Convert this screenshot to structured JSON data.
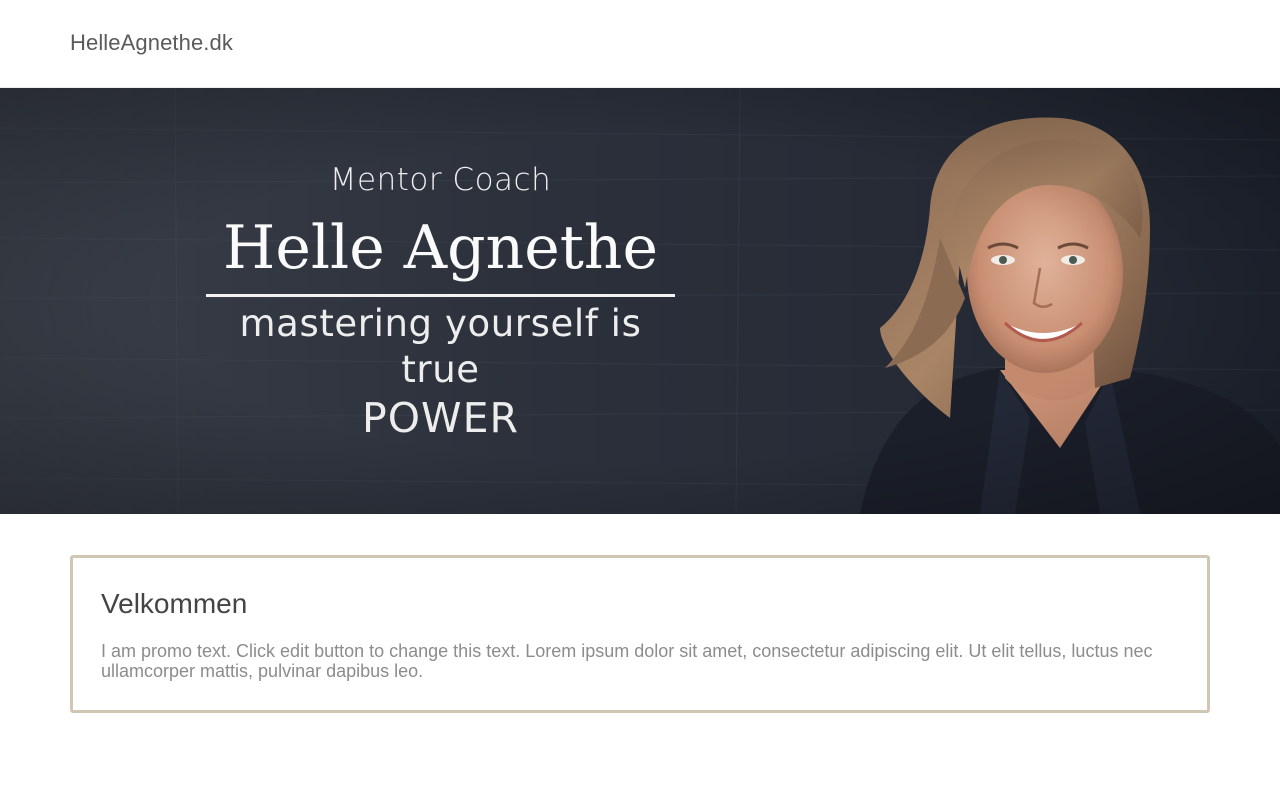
{
  "header": {
    "site_title": "HelleAgnethe.dk"
  },
  "hero": {
    "kicker": "Mentor Coach",
    "name": "Helle Agnethe",
    "tagline": "mastering yourself is true",
    "power": "POWER",
    "image_alt": "portrait-photo"
  },
  "promo": {
    "heading": "Velkommen",
    "text": "I am promo text. Click edit button to change this text. Lorem ipsum dolor sit amet, consectetur adipiscing elit. Ut elit tellus, luctus nec ullamcorper mattis, pulvinar dapibus leo."
  },
  "colors": {
    "hero_background": "#2a2f3b",
    "promo_border": "#cfc6b4",
    "heading_text": "#444444",
    "body_text": "#8c8c8c"
  }
}
